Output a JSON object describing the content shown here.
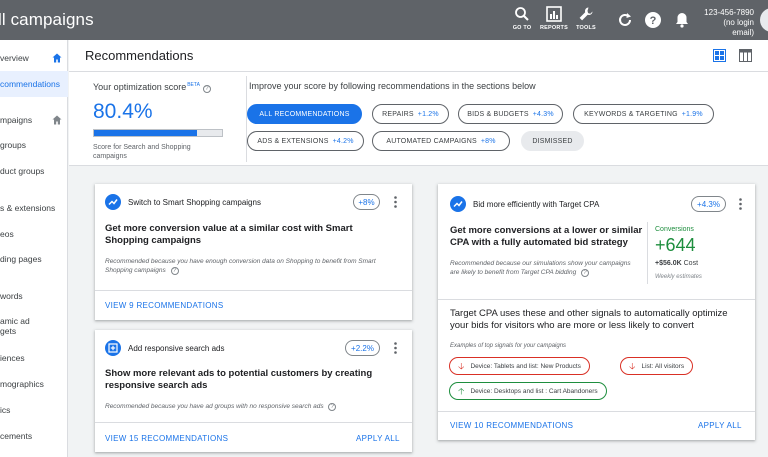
{
  "app": {
    "title": "ll campaigns"
  },
  "toolbar": {
    "goto_label": "GO TO",
    "reports_label": "REPORTS",
    "tools_label": "TOOLS",
    "refresh_icon": "refresh-icon",
    "help_icon": "help-icon",
    "notifications_icon": "bell-icon"
  },
  "account": {
    "id": "123-456-7890",
    "email": "(no login email)"
  },
  "sidebar": {
    "items": [
      {
        "label": "verview"
      },
      {
        "label": "commendations"
      },
      {
        "label": "mpaigns"
      },
      {
        "label": "groups"
      },
      {
        "label": "duct groups"
      },
      {
        "label": "s & extensions"
      },
      {
        "label": "eos"
      },
      {
        "label": "ding pages"
      },
      {
        "label": "words"
      },
      {
        "label": "amic ad"
      },
      {
        "label": "gets"
      },
      {
        "label": "iences"
      },
      {
        "label": "mographics"
      },
      {
        "label": "ics"
      },
      {
        "label": "cements"
      }
    ]
  },
  "page": {
    "title": "Recommendations"
  },
  "score": {
    "label": "Your optimization score",
    "beta": "BETA",
    "value": "80.4%",
    "progress": 0.804,
    "subtitle": "Score for Search and Shopping campaigns"
  },
  "improve": {
    "text": "Improve your score by following recommendations in the sections below",
    "chips": [
      {
        "label": "ALL RECOMMENDATIONS",
        "delta": ""
      },
      {
        "label": "REPAIRS",
        "delta": "+1.2%"
      },
      {
        "label": "BIDS & BUDGETS",
        "delta": "+4.3%"
      },
      {
        "label": "KEYWORDS & TARGETING",
        "delta": "+1.9%"
      },
      {
        "label": "ADS & EXTENSIONS",
        "delta": "+4.2%"
      },
      {
        "label": "AUTOMATED CAMPAIGNS",
        "delta": "+8%"
      },
      {
        "label": "DISMISSED",
        "delta": ""
      }
    ]
  },
  "cards": {
    "shopping": {
      "title": "Switch to Smart Shopping campaigns",
      "badge": "+8%",
      "headline": "Get more conversion value at a similar cost with Smart Shopping campaigns",
      "reason": "Recommended because you have enough conversion data on Shopping to benefit from Smart Shopping campaigns",
      "link": "VIEW 9 RECOMMENDATIONS"
    },
    "rsa": {
      "title": "Add responsive search ads",
      "badge": "+2.2%",
      "headline": "Show more relevant ads to potential customers by creating responsive search ads",
      "reason": "Recommended because you have ad groups with no responsive search ads",
      "link": "VIEW 15 RECOMMENDATIONS",
      "apply": "APPLY ALL"
    },
    "tcpa": {
      "title": "Bid more efficiently with Target CPA",
      "badge": "+4.3%",
      "headline": "Get more conversions at a lower or similar CPA with a fully automated bid strategy",
      "reason": "Recommended because our simulations show your campaigns are likely to benefit from Target CPA bidding",
      "conv_label": "Conversions",
      "conv_value": "+644",
      "cost_value": "+$56.0K",
      "cost_label": "Cost",
      "weekly": "Weekly estimates",
      "signals_text": "Target CPA uses these and other signals to automatically optimize your bids for visitors who are more or less likely to convert",
      "signals_example": "Examples of top signals for your campaigns",
      "signals": [
        {
          "label": "Device: Tablets and list: New Products",
          "direction": "down"
        },
        {
          "label": "List: All visitors",
          "direction": "down"
        },
        {
          "label": "Device: Desktops and list : Cart Abandoners",
          "direction": "up"
        }
      ],
      "link": "VIEW 10 RECOMMENDATIONS",
      "apply": "APPLY ALL"
    }
  },
  "colors": {
    "topbar": "#5f6368",
    "accent": "#1a73e8",
    "positive": "#1e8e3e",
    "negative": "#d93025"
  }
}
